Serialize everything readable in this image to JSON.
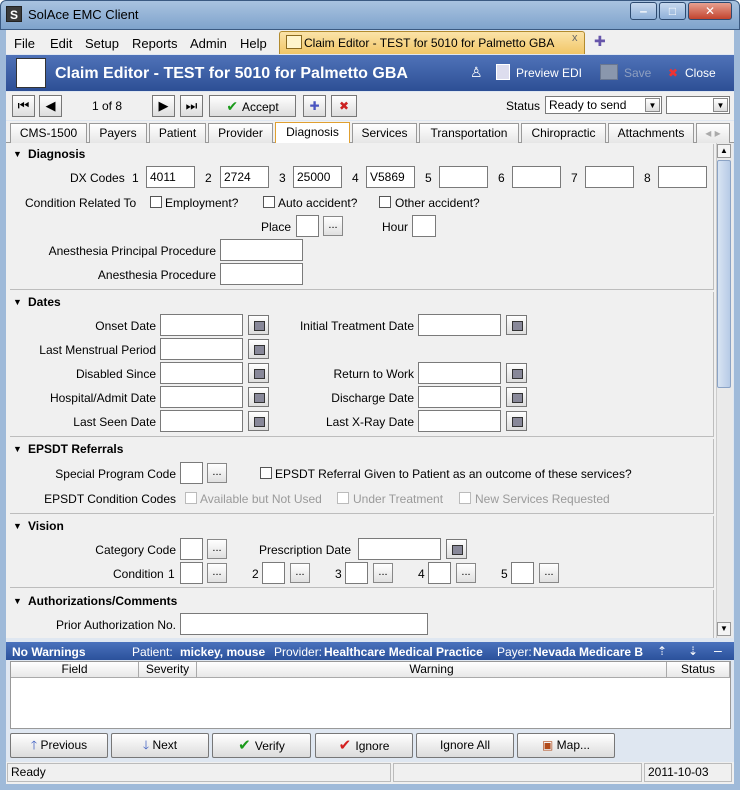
{
  "window": {
    "title": "SolAce EMC Client",
    "app_icon": "S"
  },
  "menu": {
    "file": "File",
    "edit": "Edit",
    "setup": "Setup",
    "reports": "Reports",
    "admin": "Admin",
    "help": "Help"
  },
  "doc_tab": {
    "label": "Claim Editor - TEST for 5010 for Palmetto GBA",
    "close": "x"
  },
  "header": {
    "title": "Claim Editor - TEST for 5010 for Palmetto GBA",
    "preview": "Preview EDI",
    "save": "Save",
    "close": "Close"
  },
  "toolbar": {
    "record_pos": "1 of 8",
    "accept": "Accept",
    "status_label": "Status",
    "status_value": "Ready to send",
    "status_extra": ""
  },
  "tabs": [
    "CMS-1500",
    "Payers",
    "Patient",
    "Provider",
    "Diagnosis",
    "Services",
    "Transportation",
    "Chiropractic",
    "Attachments"
  ],
  "diagnosis": {
    "title": "Diagnosis",
    "dx_label": "DX Codes",
    "dx": [
      {
        "n": "1",
        "v": "4011"
      },
      {
        "n": "2",
        "v": "2724"
      },
      {
        "n": "3",
        "v": "25000"
      },
      {
        "n": "4",
        "v": "V5869"
      },
      {
        "n": "5",
        "v": ""
      },
      {
        "n": "6",
        "v": ""
      },
      {
        "n": "7",
        "v": ""
      },
      {
        "n": "8",
        "v": ""
      }
    ],
    "condition_label": "Condition Related To",
    "employment": "Employment?",
    "auto": "Auto accident?",
    "other": "Other accident?",
    "place": "Place",
    "hour": "Hour",
    "dots": "...",
    "anes_principal": "Anesthesia Principal Procedure",
    "anes_proc": "Anesthesia Procedure"
  },
  "dates": {
    "title": "Dates",
    "onset": "Onset Date",
    "initial": "Initial Treatment Date",
    "lmp": "Last Menstrual Period",
    "disabled": "Disabled Since",
    "return": "Return to Work",
    "hospital": "Hospital/Admit Date",
    "discharge": "Discharge Date",
    "last_seen": "Last Seen Date",
    "last_xray": "Last X-Ray Date"
  },
  "epsdt": {
    "title": "EPSDT Referrals",
    "special": "Special Program Code",
    "referral": "EPSDT Referral Given to Patient as an outcome of these services?",
    "cond_label": "EPSDT Condition Codes",
    "avail": "Available but Not Used",
    "under": "Under Treatment",
    "newsvc": "New Services Requested"
  },
  "vision": {
    "title": "Vision",
    "category": "Category Code",
    "prescription": "Prescription Date",
    "condition": "Condition",
    "nums": [
      "1",
      "2",
      "3",
      "4",
      "5"
    ]
  },
  "auth": {
    "title": "Authorizations/Comments",
    "prior": "Prior Authorization No."
  },
  "warnings": {
    "summary": "No Warnings",
    "patient_label": "Patient:",
    "patient": "mickey, mouse",
    "provider_label": "Provider:",
    "provider": "Healthcare Medical Practice",
    "payer_label": "Payer:",
    "payer": "Nevada Medicare B",
    "cols": [
      "Field",
      "Severity",
      "Warning",
      "Status"
    ]
  },
  "buttons": {
    "previous": "Previous",
    "next": "Next",
    "verify": "Verify",
    "ignore": "Ignore",
    "ignore_all": "Ignore All",
    "map": "Map..."
  },
  "status": {
    "text": "Ready",
    "date": "2011-10-03"
  },
  "colors": {
    "header_blue": "#2d4f95",
    "accent_tab": "#f1c667",
    "close_red": "#c2442e"
  }
}
